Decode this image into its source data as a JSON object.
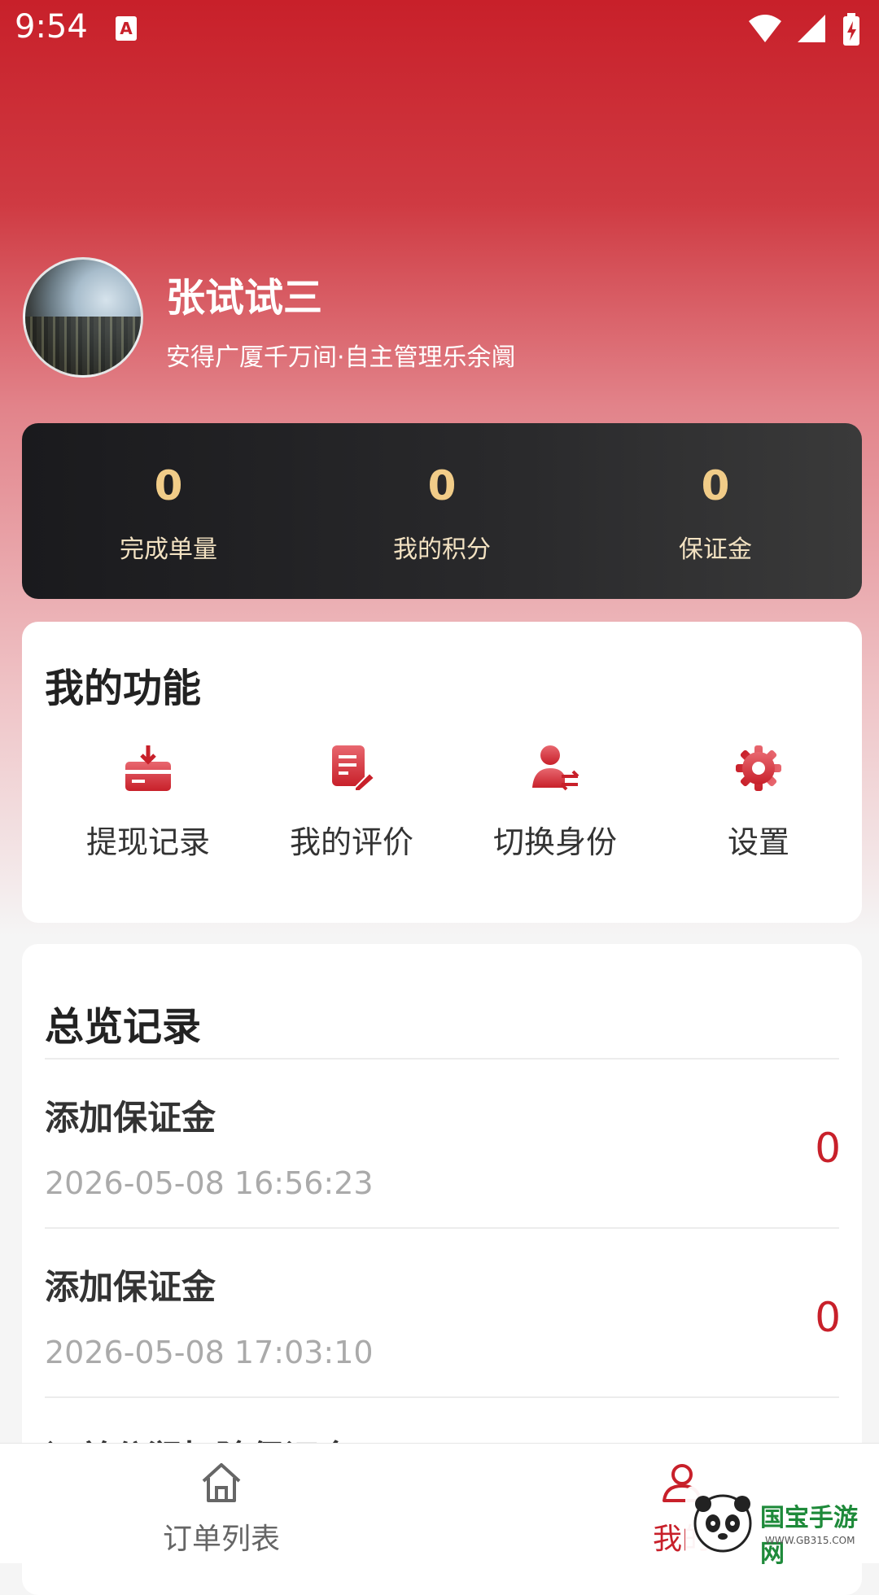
{
  "status_bar": {
    "time": "9:54",
    "app_badge": "A",
    "icons": [
      "wifi-icon",
      "signal-icon",
      "battery-icon"
    ]
  },
  "profile": {
    "name": "张试试三",
    "motto": "安得广厦千万间·自主管理乐余阛"
  },
  "stats": [
    {
      "value": "0",
      "label": "完成单量"
    },
    {
      "value": "0",
      "label": "我的积分"
    },
    {
      "value": "0",
      "label": "保证金"
    }
  ],
  "functions": {
    "title": "我的功能",
    "items": [
      {
        "label": "提现记录",
        "icon": "withdraw-icon"
      },
      {
        "label": "我的评价",
        "icon": "review-edit-icon"
      },
      {
        "label": "切换身份",
        "icon": "switch-user-icon"
      },
      {
        "label": "设置",
        "icon": "gear-icon"
      }
    ]
  },
  "overview": {
    "title": "总览记录",
    "records": [
      {
        "title": "添加保证金",
        "time": "2026-05-08 16:56:23",
        "value": "0"
      },
      {
        "title": "添加保证金",
        "time": "2026-05-08 17:03:10",
        "value": "0"
      },
      {
        "title": "订单分润扣除保证金"
      }
    ]
  },
  "tabbar": {
    "tabs": [
      {
        "label": "订单列表",
        "icon": "home-icon"
      },
      {
        "label": "我的",
        "icon": "user-icon",
        "active": true
      }
    ]
  },
  "watermark": {
    "text": "国宝手游网",
    "url": "WWW.GB315.COM"
  },
  "colors": {
    "brand_red": "#c8202a",
    "gold": "#f1cc88",
    "stats_bg": "#1a1a1d"
  }
}
